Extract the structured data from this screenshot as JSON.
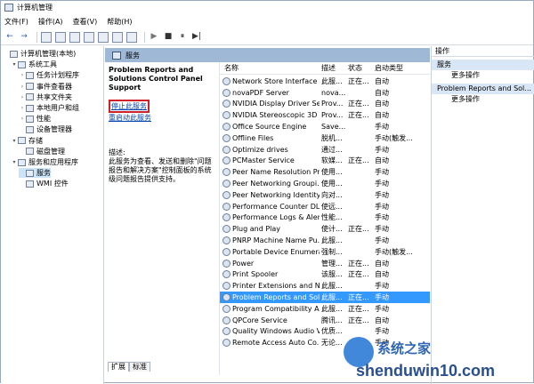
{
  "window": {
    "title": "计算机管理"
  },
  "menu": [
    "文件(F)",
    "操作(A)",
    "查看(V)",
    "帮助(H)"
  ],
  "toolbar": {
    "back": "←",
    "forward": "→",
    "play": "▶",
    "stop": "■",
    "pause": "⏸",
    "restart": "▶|"
  },
  "tree": [
    {
      "label": "计算机管理(本地)",
      "indent": 0,
      "arrow": "",
      "selected": false
    },
    {
      "label": "系统工具",
      "indent": 1,
      "arrow": "▾",
      "selected": false
    },
    {
      "label": "任务计划程序",
      "indent": 2,
      "arrow": "›",
      "selected": false
    },
    {
      "label": "事件查看器",
      "indent": 2,
      "arrow": "›",
      "selected": false
    },
    {
      "label": "共享文件夹",
      "indent": 2,
      "arrow": "›",
      "selected": false
    },
    {
      "label": "本地用户和组",
      "indent": 2,
      "arrow": "›",
      "selected": false
    },
    {
      "label": "性能",
      "indent": 2,
      "arrow": "›",
      "selected": false
    },
    {
      "label": "设备管理器",
      "indent": 2,
      "arrow": "",
      "selected": false
    },
    {
      "label": "存储",
      "indent": 1,
      "arrow": "▾",
      "selected": false
    },
    {
      "label": "磁盘管理",
      "indent": 2,
      "arrow": "",
      "selected": false
    },
    {
      "label": "服务和应用程序",
      "indent": 1,
      "arrow": "▾",
      "selected": false
    },
    {
      "label": "服务",
      "indent": 2,
      "arrow": "",
      "selected": true
    },
    {
      "label": "WMI 控件",
      "indent": 2,
      "arrow": "",
      "selected": false
    }
  ],
  "services_panel": {
    "header": "服务",
    "selected_title": "Problem Reports and Solutions Control Panel Support",
    "stop_link": "停止此服务",
    "restart_link": "重启动此服务",
    "desc_label": "描述:",
    "desc_text": "此服务为查看、发送和删除\"问题报告和解决方案\"控制面板的系统级问题报告提供支持。"
  },
  "columns": {
    "name": "名称",
    "desc": "描述",
    "status": "状态",
    "startup": "启动类型"
  },
  "services": [
    {
      "name": "Network Store Interface ...",
      "desc": "此服...",
      "status": "正在...",
      "startup": "自动"
    },
    {
      "name": "novaPDF Server",
      "desc": "nova...",
      "status": "",
      "startup": "自动"
    },
    {
      "name": "NVIDIA Display Driver Se...",
      "desc": "Prov...",
      "status": "正在...",
      "startup": "自动"
    },
    {
      "name": "NVIDIA Stereoscopic 3D ...",
      "desc": "Prov...",
      "status": "正在...",
      "startup": "自动"
    },
    {
      "name": "Office Source Engine",
      "desc": "Save...",
      "status": "",
      "startup": "手动"
    },
    {
      "name": "Offline Files",
      "desc": "脱机...",
      "status": "",
      "startup": "手动(触发..."
    },
    {
      "name": "Optimize drives",
      "desc": "通过...",
      "status": "",
      "startup": "手动"
    },
    {
      "name": "PCMaster Service",
      "desc": "软媒...",
      "status": "正在...",
      "startup": "自动"
    },
    {
      "name": "Peer Name Resolution Pr...",
      "desc": "使用...",
      "status": "",
      "startup": "手动"
    },
    {
      "name": "Peer Networking Groupi...",
      "desc": "使用...",
      "status": "",
      "startup": "手动"
    },
    {
      "name": "Peer Networking Identity...",
      "desc": "向对...",
      "status": "",
      "startup": "手动"
    },
    {
      "name": "Performance Counter DL...",
      "desc": "使远...",
      "status": "",
      "startup": "手动"
    },
    {
      "name": "Performance Logs & Aler...",
      "desc": "性能...",
      "status": "",
      "startup": "手动"
    },
    {
      "name": "Plug and Play",
      "desc": "使计...",
      "status": "正在...",
      "startup": "手动"
    },
    {
      "name": "PNRP Machine Name Pu...",
      "desc": "此服...",
      "status": "",
      "startup": "手动"
    },
    {
      "name": "Portable Device Enumera...",
      "desc": "强制...",
      "status": "",
      "startup": "手动(触发..."
    },
    {
      "name": "Power",
      "desc": "管理...",
      "status": "正在...",
      "startup": "自动"
    },
    {
      "name": "Print Spooler",
      "desc": "该服...",
      "status": "正在...",
      "startup": "自动"
    },
    {
      "name": "Printer Extensions and N...",
      "desc": "此服...",
      "status": "",
      "startup": "手动"
    },
    {
      "name": "Problem Reports and Sol...",
      "desc": "此服...",
      "status": "正在...",
      "startup": "手动"
    },
    {
      "name": "Program Compatibility A...",
      "desc": "此服...",
      "status": "正在...",
      "startup": "手动"
    },
    {
      "name": "QPCore Service",
      "desc": "腾讯...",
      "status": "正在...",
      "startup": "自动"
    },
    {
      "name": "Quality Windows Audio V...",
      "desc": "优质...",
      "status": "",
      "startup": "手动"
    },
    {
      "name": "Remote Access Auto Co...",
      "desc": "无论...",
      "status": "",
      "startup": "手动"
    }
  ],
  "tabs": [
    "扩展",
    "标准"
  ],
  "actions": {
    "header": "操作",
    "section1": "服务",
    "more1": "更多操作",
    "section2": "Problem Reports and Sol...",
    "more2": "更多操作"
  },
  "watermark": {
    "text1": "系统之家",
    "text2": "shenduwin10.com"
  }
}
